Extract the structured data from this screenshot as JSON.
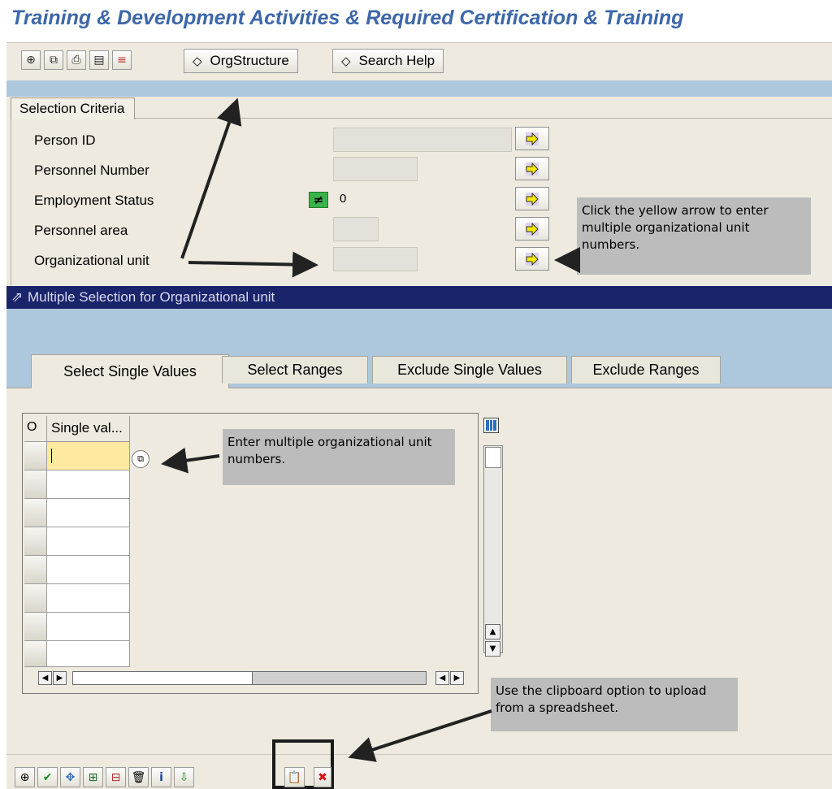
{
  "title": "Training & Development Activities & Required Certification & Training",
  "toolbar": {
    "icons": [
      "execute-icon",
      "save-variant-icon",
      "print-icon",
      "get-variant-icon",
      "dynamic-selection-icon"
    ],
    "orgstructure_label": "OrgStructure",
    "searchhelp_label": "Search Help"
  },
  "selection": {
    "tab_label": "Selection Criteria",
    "fields": [
      {
        "label": "Person ID"
      },
      {
        "label": "Personnel Number"
      },
      {
        "label": "Employment Status",
        "value": "0"
      },
      {
        "label": "Personnel area"
      },
      {
        "label": "Organizational unit"
      }
    ]
  },
  "callouts": {
    "yellow_arrow": "Click the yellow arrow to enter multiple organizational unit numbers.",
    "enter_multiple": "Enter multiple organizational unit numbers.",
    "clipboard": "Use the clipboard option to upload from a spreadsheet."
  },
  "dialog": {
    "title": "Multiple Selection for Organizational unit",
    "tabs": [
      "Select Single Values",
      "Select Ranges",
      "Exclude Single Values",
      "Exclude Ranges"
    ],
    "active_tab": "Select Single Values",
    "col_option": "O",
    "col_value": "Single val..."
  },
  "bottom_toolbar": {
    "icons": [
      "execute-icon",
      "check-icon",
      "multiple-icon",
      "insert-line-icon",
      "delete-line-icon",
      "delete-all-icon",
      "help-icon",
      "import-text-icon",
      "clipboard-upload-icon",
      "cancel-icon"
    ]
  },
  "colors": {
    "title": "#3d67a8",
    "sap_beige": "#eeeadf",
    "light_blue": "#adc8dc",
    "dialog_title_bar": "#1a246b",
    "callout_gray": "#bcbcbc",
    "active_input": "#fde9a0",
    "arrow_yellow": "#f6e700"
  }
}
